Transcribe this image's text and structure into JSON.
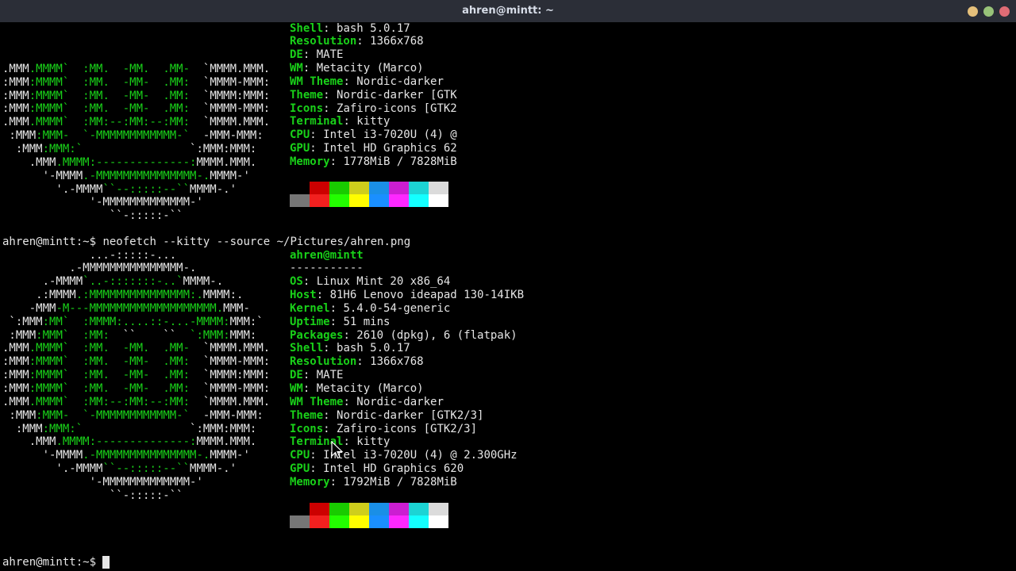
{
  "window": {
    "title": "ahren@mintt: ~"
  },
  "prompt": "ahren@mintt:~$ ",
  "command": "neofetch --kitty --source ~/Pictures/ahren.png",
  "palette": {
    "top": [
      "#000000",
      "#cc0000",
      "#19cb00",
      "#cece1c",
      "#1a8fe6",
      "#cb1ed1",
      "#1cd4d4",
      "#dbdbdb"
    ],
    "bottom": [
      "#767676",
      "#f2201f",
      "#23fd00",
      "#fffd00",
      "#1a8fff",
      "#fd28ff",
      "#14ffff",
      "#ffffff"
    ]
  },
  "first_output": {
    "logo": [
      [
        [
          ".MMM",
          "w"
        ],
        [
          ".MMMM`",
          "g"
        ],
        [
          "  ",
          "w"
        ],
        [
          ":MM.",
          "g"
        ],
        [
          "  ",
          "w"
        ],
        [
          "-MM.",
          "g"
        ],
        [
          "  ",
          "w"
        ],
        [
          ".MM-",
          "g"
        ],
        [
          "  ",
          "w"
        ],
        [
          "`MMMM.MMM.",
          "w"
        ]
      ],
      [
        [
          ":MMM",
          "w"
        ],
        [
          ":MMMM`",
          "g"
        ],
        [
          "  ",
          "w"
        ],
        [
          ":MM.",
          "g"
        ],
        [
          "  ",
          "w"
        ],
        [
          "-MM-",
          "g"
        ],
        [
          "  ",
          "w"
        ],
        [
          ".MM:",
          "g"
        ],
        [
          "  ",
          "w"
        ],
        [
          "`MMMM-MMM:",
          "w"
        ]
      ],
      [
        [
          ":MMM",
          "w"
        ],
        [
          ":MMMM`",
          "g"
        ],
        [
          "  ",
          "w"
        ],
        [
          ":MM.",
          "g"
        ],
        [
          "  ",
          "w"
        ],
        [
          "-MM-",
          "g"
        ],
        [
          "  ",
          "w"
        ],
        [
          ".MM:",
          "g"
        ],
        [
          "  ",
          "w"
        ],
        [
          "`MMMM:MMM:",
          "w"
        ]
      ],
      [
        [
          ":MMM",
          "w"
        ],
        [
          ":MMMM`",
          "g"
        ],
        [
          "  ",
          "w"
        ],
        [
          ":MM.",
          "g"
        ],
        [
          "  ",
          "w"
        ],
        [
          "-MM-",
          "g"
        ],
        [
          "  ",
          "w"
        ],
        [
          ".MM:",
          "g"
        ],
        [
          "  ",
          "w"
        ],
        [
          "`MMMM-MMM:",
          "w"
        ]
      ],
      [
        [
          ".MMM",
          "w"
        ],
        [
          ".MMMM`",
          "g"
        ],
        [
          "  ",
          "w"
        ],
        [
          ":MM:--:MM:--:MM:",
          "g"
        ],
        [
          "  ",
          "w"
        ],
        [
          "`MMMM.MMM.",
          "w"
        ]
      ],
      [
        [
          " :MMM",
          "w"
        ],
        [
          ":MMM-",
          "g"
        ],
        [
          "  ",
          "w"
        ],
        [
          "`-MMMMMMMMMMMM-`",
          "g"
        ],
        [
          "  ",
          "w"
        ],
        [
          "-MMM-MMM:",
          "w"
        ]
      ],
      [
        [
          "  :MMM",
          "w"
        ],
        [
          ":MMM:`",
          "g"
        ],
        [
          "                ",
          "w"
        ],
        [
          "`:MMM:MMM:",
          "w"
        ]
      ],
      [
        [
          "    .MMM",
          "w"
        ],
        [
          ".MMMM:--------------:",
          "g"
        ],
        [
          "MMMM.MMM.",
          "w"
        ]
      ],
      [
        [
          "      '-MMMM",
          "w"
        ],
        [
          ".-MMMMMMMMMMMMMMM-.",
          "g"
        ],
        [
          "MMMM-'",
          "w"
        ]
      ],
      [
        [
          "        '.-MMMM",
          "w"
        ],
        [
          "``--:::::--``",
          "g"
        ],
        [
          "MMMM-.'",
          "w"
        ]
      ],
      [
        [
          "             '-MMMMMMMMMMMMM-'",
          "w"
        ]
      ],
      [
        [
          "                ``-:::::-``",
          "w"
        ]
      ]
    ],
    "info": [
      [
        "Shell",
        "bash 5.0.17"
      ],
      [
        "Resolution",
        "1366x768"
      ],
      [
        "DE",
        "MATE"
      ],
      [
        "WM",
        "Metacity (Marco)"
      ],
      [
        "WM Theme",
        "Nordic-darker"
      ],
      [
        "Theme",
        "Nordic-darker [GTK"
      ],
      [
        "Icons",
        "Zafiro-icons [GTK2"
      ],
      [
        "Terminal",
        "kitty"
      ],
      [
        "CPU",
        "Intel i3-7020U (4) @"
      ],
      [
        "GPU",
        "Intel HD Graphics 62"
      ],
      [
        "Memory",
        "1778MiB / 7828MiB"
      ]
    ]
  },
  "second_output": {
    "logo": [
      [
        [
          "             ...-:::::-...",
          "w"
        ]
      ],
      [
        [
          "          .-MMMMMMMMMMMMMMM-.",
          "w"
        ]
      ],
      [
        [
          "      .-MMMM",
          "w"
        ],
        [
          "`..-:::::::-..`",
          "g"
        ],
        [
          "MMMM-.",
          "w"
        ]
      ],
      [
        [
          "     .:MMMM",
          "w"
        ],
        [
          ".:MMMMMMMMMMMMMMM:.",
          "g"
        ],
        [
          "MMMM:.",
          "w"
        ]
      ],
      [
        [
          "    -MMM",
          "w"
        ],
        [
          "-M---MMMMMMMMMMMMMMMMMMM.",
          "g"
        ],
        [
          "MMM-",
          "w"
        ]
      ],
      [
        [
          " `:MMM",
          "w"
        ],
        [
          ":MM`",
          "g"
        ],
        [
          "  ",
          "w"
        ],
        [
          ":MMMM:....::-...-MMMM:",
          "g"
        ],
        [
          "MMM:`",
          "w"
        ]
      ],
      [
        [
          " :MMM",
          "w"
        ],
        [
          ":MMM`",
          "g"
        ],
        [
          "  ",
          "w"
        ],
        [
          ":MM:",
          "g"
        ],
        [
          "  ``    ``  ",
          "w"
        ],
        [
          "`:MMM:",
          "g"
        ],
        [
          "MMM:",
          "w"
        ]
      ],
      [
        [
          ".MMM",
          "w"
        ],
        [
          ".MMMM`",
          "g"
        ],
        [
          "  ",
          "w"
        ],
        [
          ":MM.",
          "g"
        ],
        [
          "  ",
          "w"
        ],
        [
          "-MM.",
          "g"
        ],
        [
          "  ",
          "w"
        ],
        [
          ".MM-",
          "g"
        ],
        [
          "  ",
          "w"
        ],
        [
          "`MMMM.MMM.",
          "w"
        ]
      ],
      [
        [
          ":MMM",
          "w"
        ],
        [
          ":MMMM`",
          "g"
        ],
        [
          "  ",
          "w"
        ],
        [
          ":MM.",
          "g"
        ],
        [
          "  ",
          "w"
        ],
        [
          "-MM-",
          "g"
        ],
        [
          "  ",
          "w"
        ],
        [
          ".MM:",
          "g"
        ],
        [
          "  ",
          "w"
        ],
        [
          "`MMMM-MMM:",
          "w"
        ]
      ],
      [
        [
          ":MMM",
          "w"
        ],
        [
          ":MMMM`",
          "g"
        ],
        [
          "  ",
          "w"
        ],
        [
          ":MM.",
          "g"
        ],
        [
          "  ",
          "w"
        ],
        [
          "-MM-",
          "g"
        ],
        [
          "  ",
          "w"
        ],
        [
          ".MM:",
          "g"
        ],
        [
          "  ",
          "w"
        ],
        [
          "`MMMM:MMM:",
          "w"
        ]
      ],
      [
        [
          ":MMM",
          "w"
        ],
        [
          ":MMMM`",
          "g"
        ],
        [
          "  ",
          "w"
        ],
        [
          ":MM.",
          "g"
        ],
        [
          "  ",
          "w"
        ],
        [
          "-MM-",
          "g"
        ],
        [
          "  ",
          "w"
        ],
        [
          ".MM:",
          "g"
        ],
        [
          "  ",
          "w"
        ],
        [
          "`MMMM-MMM:",
          "w"
        ]
      ],
      [
        [
          ".MMM",
          "w"
        ],
        [
          ".MMMM`",
          "g"
        ],
        [
          "  ",
          "w"
        ],
        [
          ":MM:--:MM:--:MM:",
          "g"
        ],
        [
          "  ",
          "w"
        ],
        [
          "`MMMM.MMM.",
          "w"
        ]
      ],
      [
        [
          " :MMM",
          "w"
        ],
        [
          ":MMM-",
          "g"
        ],
        [
          "  ",
          "w"
        ],
        [
          "`-MMMMMMMMMMMM-`",
          "g"
        ],
        [
          "  ",
          "w"
        ],
        [
          "-MMM-MMM:",
          "w"
        ]
      ],
      [
        [
          "  :MMM",
          "w"
        ],
        [
          ":MMM:`",
          "g"
        ],
        [
          "                ",
          "w"
        ],
        [
          "`:MMM:MMM:",
          "w"
        ]
      ],
      [
        [
          "    .MMM",
          "w"
        ],
        [
          ".MMMM:--------------:",
          "g"
        ],
        [
          "MMMM.MMM.",
          "w"
        ]
      ],
      [
        [
          "      '-MMMM",
          "w"
        ],
        [
          ".-MMMMMMMMMMMMMMM-.",
          "g"
        ],
        [
          "MMMM-'",
          "w"
        ]
      ],
      [
        [
          "        '.-MMMM",
          "w"
        ],
        [
          "``--:::::--``",
          "g"
        ],
        [
          "MMMM-.'",
          "w"
        ]
      ],
      [
        [
          "             '-MMMMMMMMMMMMM-'",
          "w"
        ]
      ],
      [
        [
          "                ``-:::::-``",
          "w"
        ]
      ]
    ],
    "header": "ahren@mintt",
    "separator": "-----------",
    "info": [
      [
        "OS",
        "Linux Mint 20 x86_64"
      ],
      [
        "Host",
        "81H6 Lenovo ideapad 130-14IKB"
      ],
      [
        "Kernel",
        "5.4.0-54-generic"
      ],
      [
        "Uptime",
        "51 mins"
      ],
      [
        "Packages",
        "2610 (dpkg), 6 (flatpak)"
      ],
      [
        "Shell",
        "bash 5.0.17"
      ],
      [
        "Resolution",
        "1366x768"
      ],
      [
        "DE",
        "MATE"
      ],
      [
        "WM",
        "Metacity (Marco)"
      ],
      [
        "WM Theme",
        "Nordic-darker"
      ],
      [
        "Theme",
        "Nordic-darker [GTK2/3]"
      ],
      [
        "Icons",
        "Zafiro-icons [GTK2/3]"
      ],
      [
        "Terminal",
        "kitty"
      ],
      [
        "CPU",
        "Intel i3-7020U (4) @ 2.300GHz"
      ],
      [
        "GPU",
        "Intel HD Graphics 620"
      ],
      [
        "Memory",
        "1792MiB / 7828MiB"
      ]
    ]
  }
}
